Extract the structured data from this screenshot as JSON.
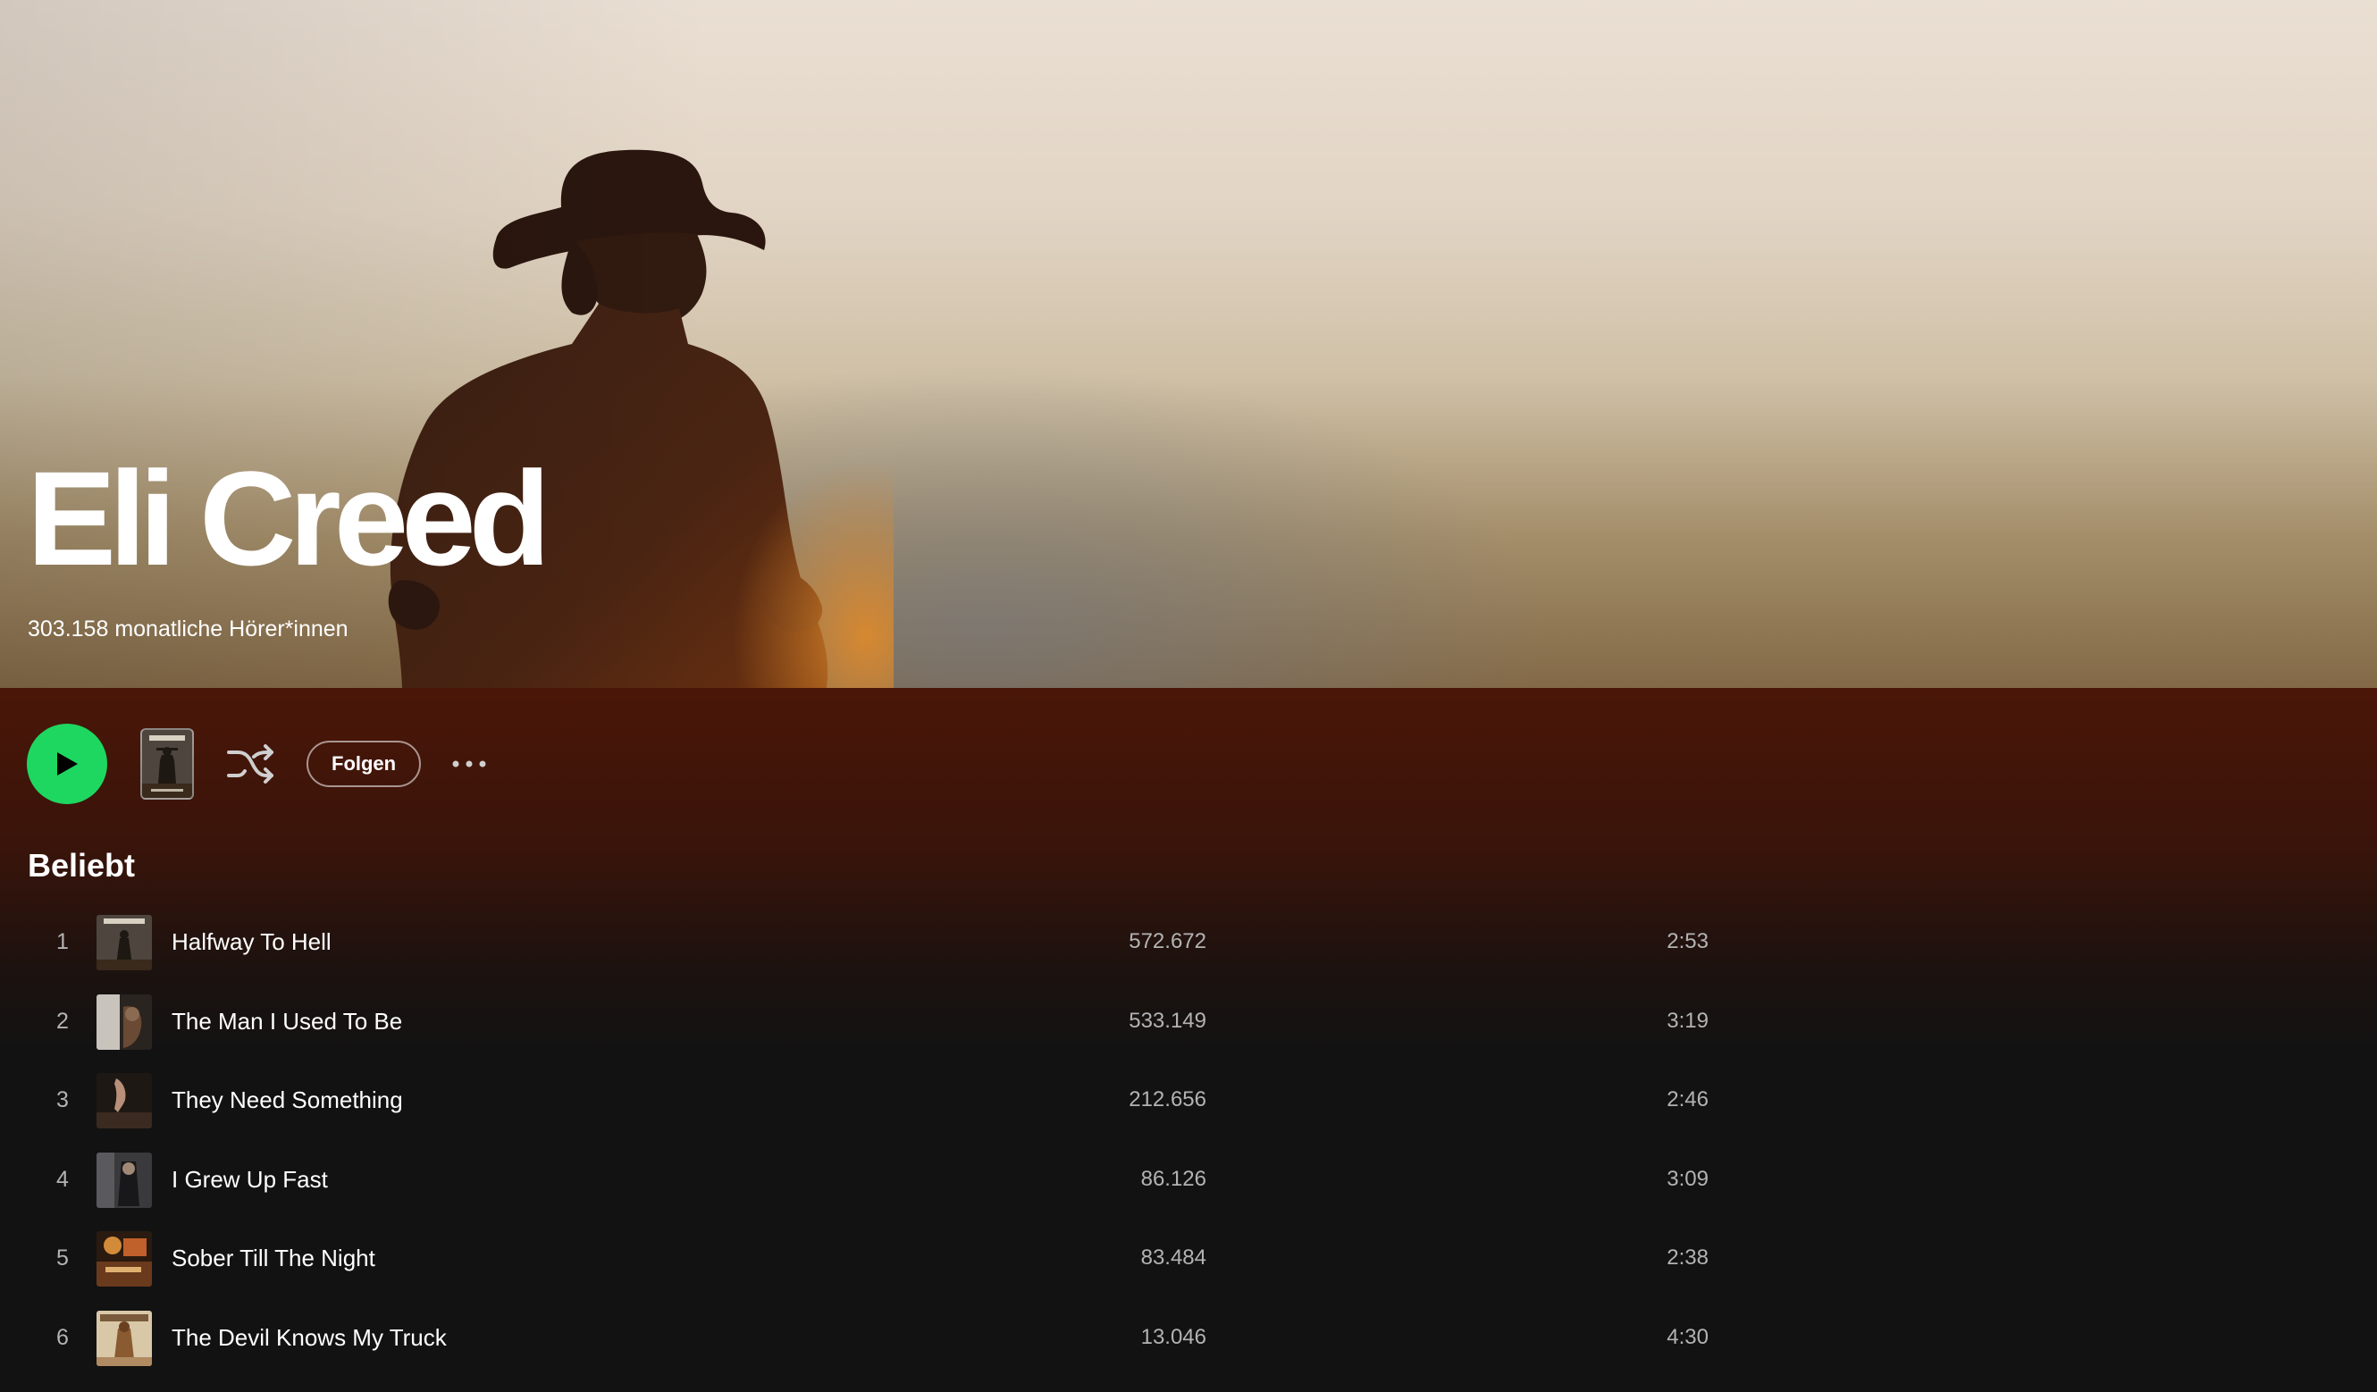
{
  "artist": {
    "name": "Eli Creed",
    "monthly_listeners": "303.158 monatliche Hörer*innen"
  },
  "actions": {
    "play_icon": "play-icon",
    "shuffle_icon": "shuffle-icon",
    "follow_label": "Folgen",
    "more_icon": "more-options-icon"
  },
  "colors": {
    "accent": "#1ed760",
    "background": "#121212",
    "header_tint": "#4a1608"
  },
  "popular": {
    "title": "Beliebt",
    "tracks": [
      {
        "num": "1",
        "title": "Halfway To Hell",
        "plays": "572.672",
        "duration": "2:53"
      },
      {
        "num": "2",
        "title": "The Man I Used To Be",
        "plays": "533.149",
        "duration": "3:19"
      },
      {
        "num": "3",
        "title": "They Need Something",
        "plays": "212.656",
        "duration": "2:46"
      },
      {
        "num": "4",
        "title": "I Grew Up Fast",
        "plays": "86.126",
        "duration": "3:09"
      },
      {
        "num": "5",
        "title": "Sober Till The Night",
        "plays": "83.484",
        "duration": "2:38"
      },
      {
        "num": "6",
        "title": "The Devil Knows My Truck",
        "plays": "13.046",
        "duration": "4:30"
      }
    ]
  }
}
